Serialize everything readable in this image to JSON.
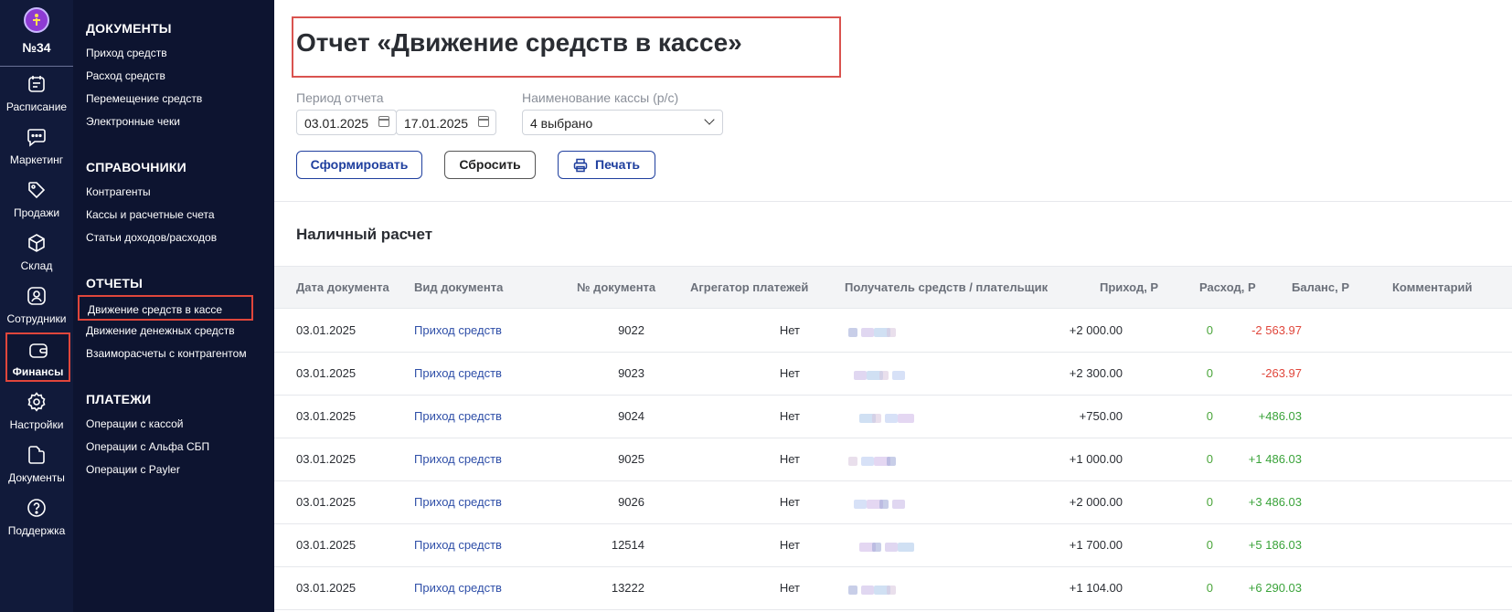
{
  "rail": {
    "branch": "№34",
    "items": [
      {
        "label": "Расписание",
        "icon": "calendar-icon"
      },
      {
        "label": "Маркетинг",
        "icon": "chat-icon"
      },
      {
        "label": "Продажи",
        "icon": "tag-icon"
      },
      {
        "label": "Склад",
        "icon": "box-icon"
      },
      {
        "label": "Сотрудники",
        "icon": "user-icon"
      },
      {
        "label": "Финансы",
        "icon": "wallet-icon",
        "active": true
      },
      {
        "label": "Настройки",
        "icon": "gear-icon"
      },
      {
        "label": "Документы",
        "icon": "folder-icon"
      },
      {
        "label": "Поддержка",
        "icon": "help-icon"
      }
    ]
  },
  "menu": {
    "docs_heading": "ДОКУМЕНТЫ",
    "docs": [
      "Приход средств",
      "Расход средств",
      "Перемещение средств",
      "Электронные чеки"
    ],
    "refs_heading": "СПРАВОЧНИКИ",
    "refs": [
      "Контрагенты",
      "Кассы и расчетные счета",
      "Статьи доходов/расходов"
    ],
    "reports_heading": "ОТЧЕТЫ",
    "reports": [
      "Движение средств в кассе",
      "Движение денежных средств",
      "Взаиморасчеты с контрагентом"
    ],
    "payments_heading": "ПЛАТЕЖИ",
    "payments": [
      "Операции с кассой",
      "Операции с Альфа СБП",
      "Операции с Payler"
    ]
  },
  "page": {
    "title": "Отчет «Движение средств в кассе»",
    "period_label": "Период отчета",
    "date_from": "03.01.2025",
    "date_to": "17.01.2025",
    "cashbox_label": "Наименование кассы (р/с)",
    "cashbox_value": "4 выбрано",
    "btn_generate": "Сформировать",
    "btn_reset": "Сбросить",
    "btn_print": "Печать",
    "section_title": "Наличный расчет"
  },
  "table": {
    "headers": [
      "Дата документа",
      "Вид документа",
      "№ документа",
      "Агрегатор платежей",
      "Получатель средств / плательщик",
      "Приход, Р",
      "Расход, Р",
      "Баланс, Р",
      "Комментарий"
    ],
    "rows": [
      {
        "date": "03.01.2025",
        "type": "Приход средств",
        "num": "9022",
        "agg": "Нет",
        "income": "+2 000.00",
        "expense": "0",
        "balance": "-2 563.97",
        "neg": true
      },
      {
        "date": "03.01.2025",
        "type": "Приход средств",
        "num": "9023",
        "agg": "Нет",
        "income": "+2 300.00",
        "expense": "0",
        "balance": "-263.97",
        "neg": true
      },
      {
        "date": "03.01.2025",
        "type": "Приход средств",
        "num": "9024",
        "agg": "Нет",
        "income": "+750.00",
        "expense": "0",
        "balance": "+486.03",
        "neg": false
      },
      {
        "date": "03.01.2025",
        "type": "Приход средств",
        "num": "9025",
        "agg": "Нет",
        "income": "+1 000.00",
        "expense": "0",
        "balance": "+1 486.03",
        "neg": false
      },
      {
        "date": "03.01.2025",
        "type": "Приход средств",
        "num": "9026",
        "agg": "Нет",
        "income": "+2 000.00",
        "expense": "0",
        "balance": "+3 486.03",
        "neg": false
      },
      {
        "date": "03.01.2025",
        "type": "Приход средств",
        "num": "12514",
        "agg": "Нет",
        "income": "+1 700.00",
        "expense": "0",
        "balance": "+5 186.03",
        "neg": false
      },
      {
        "date": "03.01.2025",
        "type": "Приход средств",
        "num": "13222",
        "agg": "Нет",
        "income": "+1 104.00",
        "expense": "0",
        "balance": "+6 290.03",
        "neg": false
      }
    ]
  }
}
